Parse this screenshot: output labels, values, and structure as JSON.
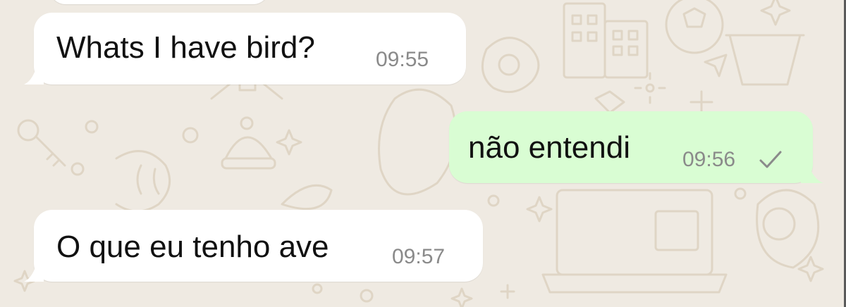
{
  "colors": {
    "background": "#efeae2",
    "incoming_bubble": "#ffffff",
    "outgoing_bubble": "#d9fdd3",
    "text": "#111111",
    "timestamp": "#8a8a8a"
  },
  "messages": [
    {
      "direction": "incoming",
      "text": "Whats I have bird?",
      "time": "09:55"
    },
    {
      "direction": "outgoing",
      "text": "não entendi",
      "time": "09:56",
      "status_icon": "single-check-icon"
    },
    {
      "direction": "incoming",
      "text": "O que eu tenho ave",
      "time": "09:57"
    }
  ]
}
